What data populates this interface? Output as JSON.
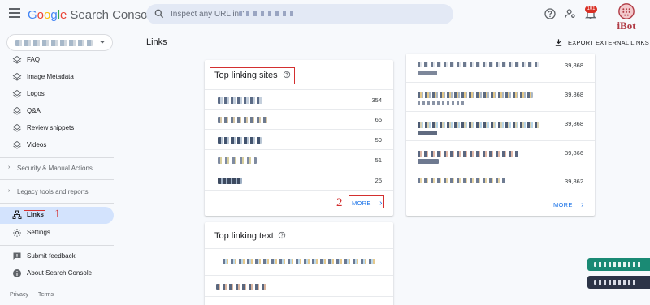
{
  "header": {
    "brand_google": [
      "G",
      "o",
      "o",
      "g",
      "l",
      "e"
    ],
    "brand_product": "Search Console",
    "search_placeholder": "Inspect any URL in \"",
    "notification_count": "101",
    "watermark": "iBot"
  },
  "sidebar": {
    "items_top": [
      {
        "label": "FAQ",
        "icon": "layers-icon"
      },
      {
        "label": "Image Metadata",
        "icon": "layers-icon"
      },
      {
        "label": "Logos",
        "icon": "layers-icon"
      },
      {
        "label": "Q&A",
        "icon": "layers-icon"
      },
      {
        "label": "Review snippets",
        "icon": "layers-icon"
      },
      {
        "label": "Videos",
        "icon": "layers-icon"
      }
    ],
    "sections": [
      "Security & Manual Actions",
      "Legacy tools and reports"
    ],
    "items_bottom": [
      {
        "label": "Links",
        "icon": "sitemap-icon",
        "active": true
      },
      {
        "label": "Settings",
        "icon": "gear-icon"
      },
      {
        "label": "Submit feedback",
        "icon": "feedback-icon"
      },
      {
        "label": "About Search Console",
        "icon": "info-icon"
      }
    ],
    "footer": [
      "Privacy",
      "Terms"
    ]
  },
  "annotations": {
    "callout_1": "1",
    "callout_2": "2"
  },
  "main": {
    "title": "Links",
    "export_label": "EXPORT EXTERNAL LINKS",
    "top_linking_sites": {
      "title": "Top linking sites",
      "values": [
        "354",
        "65",
        "59",
        "51",
        "25"
      ],
      "more_label": "MORE"
    },
    "right_card": {
      "values": [
        "39,868",
        "39,868",
        "39,868",
        "39,866",
        "39,862"
      ],
      "more_label": "MORE"
    },
    "top_linking_text": {
      "title": "Top linking text"
    }
  },
  "colors": {
    "accent": "#1a73e8",
    "active_nav": "#d3e3fd",
    "annotation_red": "#d32f2f",
    "background": "#f7f9fc"
  }
}
